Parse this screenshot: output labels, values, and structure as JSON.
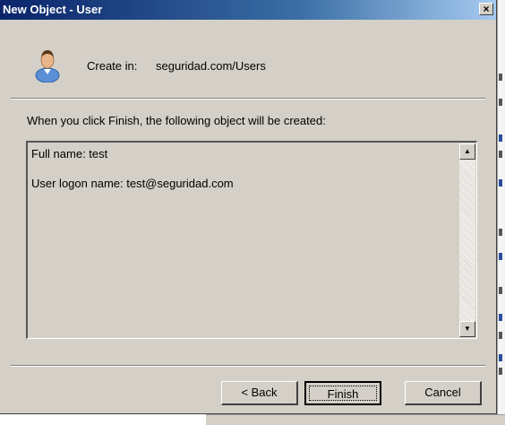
{
  "dialog": {
    "title": "New Object - User",
    "close_label": "×",
    "create_in_label": "Create in:",
    "create_in_path": "seguridad.com/Users",
    "info_text": "When you click Finish, the following object will be created:",
    "summary": {
      "full_name_line": "Full name: test",
      "logon_name_line": "User logon name: test@seguridad.com"
    },
    "scroll_up": "▲",
    "scroll_down": "▼",
    "buttons": {
      "back": "< Back",
      "finish": "Finish",
      "cancel": "Cancel"
    }
  },
  "colors": {
    "dialog_bg": "#d4d0c8",
    "titlebar_start": "#0a246a",
    "titlebar_end": "#a6caf0"
  },
  "icons": [
    "user-icon",
    "close-icon",
    "scroll-up-arrow-icon",
    "scroll-down-arrow-icon"
  ]
}
